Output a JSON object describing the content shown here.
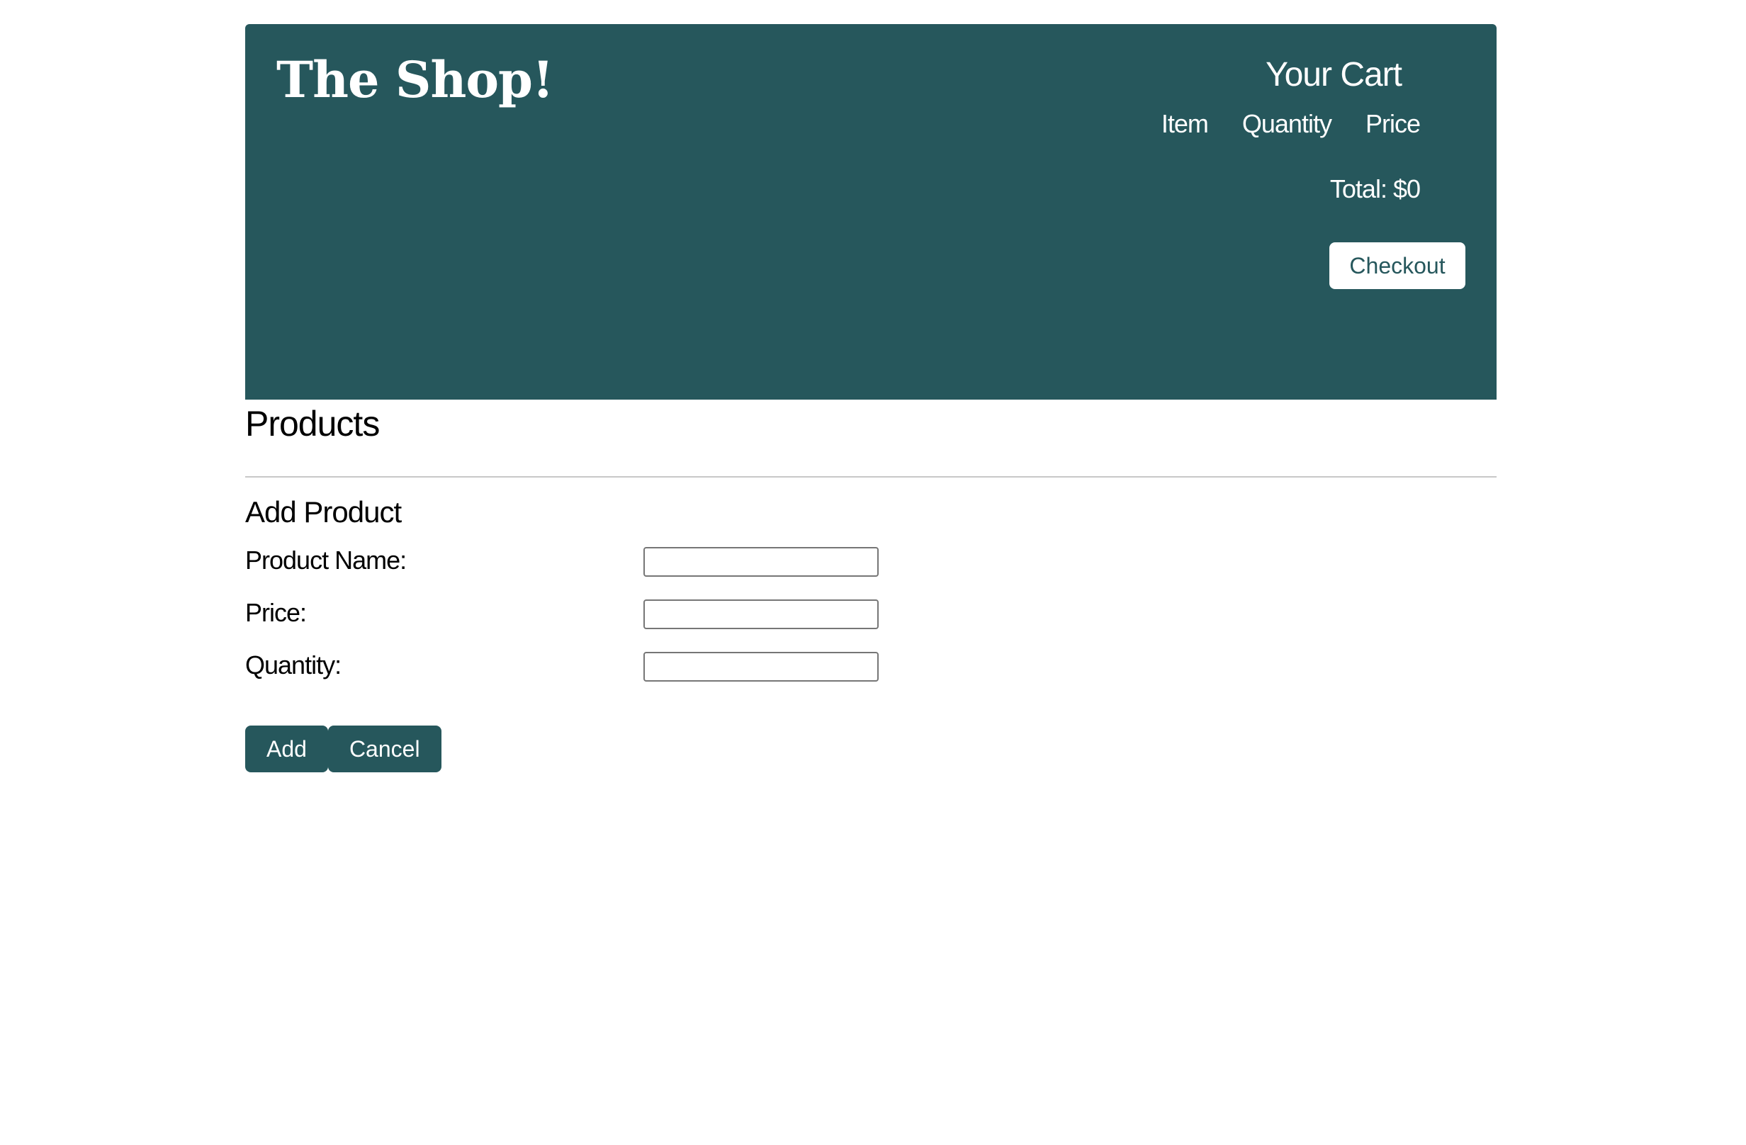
{
  "header": {
    "brand": "The Shop!",
    "cart": {
      "title": "Your Cart",
      "columns": [
        "Item",
        "Quantity",
        "Price"
      ],
      "total": "Total: $0",
      "checkout_label": "Checkout"
    }
  },
  "main": {
    "products_title": "Products",
    "add_product": {
      "title": "Add Product",
      "fields": [
        {
          "label": "Product Name:",
          "value": ""
        },
        {
          "label": "Price:",
          "value": ""
        },
        {
          "label": "Quantity:",
          "value": ""
        }
      ],
      "add_label": "Add",
      "cancel_label": "Cancel"
    }
  },
  "colors": {
    "brand": "#26575c",
    "background": "#ffffff",
    "divider": "#c8c8c8"
  }
}
